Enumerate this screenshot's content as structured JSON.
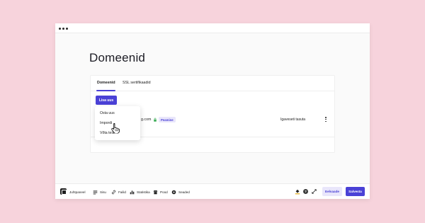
{
  "page": {
    "title": "Domeenid"
  },
  "tabs": [
    {
      "label": "Domeenid",
      "active": true
    },
    {
      "label": "SSL sertifikaadid",
      "active": false
    }
  ],
  "actions": {
    "add_label": "Lisa uus"
  },
  "dropdown": {
    "items": [
      "Osta uus",
      "Impordi",
      "Võta teised"
    ]
  },
  "domain_row": {
    "name_partial": "g.com",
    "status": "Peamine",
    "renewal": "Igaveseti tasuta",
    "lock_icon": "lock-icon",
    "menu_icon": "kebab-menu-icon"
  },
  "bottom_bar": {
    "logo_label": "Juhtpaneel",
    "nav": [
      {
        "label": "Sisu",
        "icon": "content-icon"
      },
      {
        "label": "Failid",
        "icon": "link-icon"
      },
      {
        "label": "Statistika",
        "icon": "statistics-icon"
      },
      {
        "label": "Pood",
        "icon": "store-icon"
      },
      {
        "label": "Seaded",
        "icon": "gear-icon"
      }
    ],
    "help_label": "?",
    "preview_label": "Eelvaade",
    "save_label": "Salvesta"
  },
  "colors": {
    "accent": "#4a41d6",
    "accent_light": "#e9e6fb",
    "background": "#f7d3dc",
    "window": "#fafafa"
  }
}
